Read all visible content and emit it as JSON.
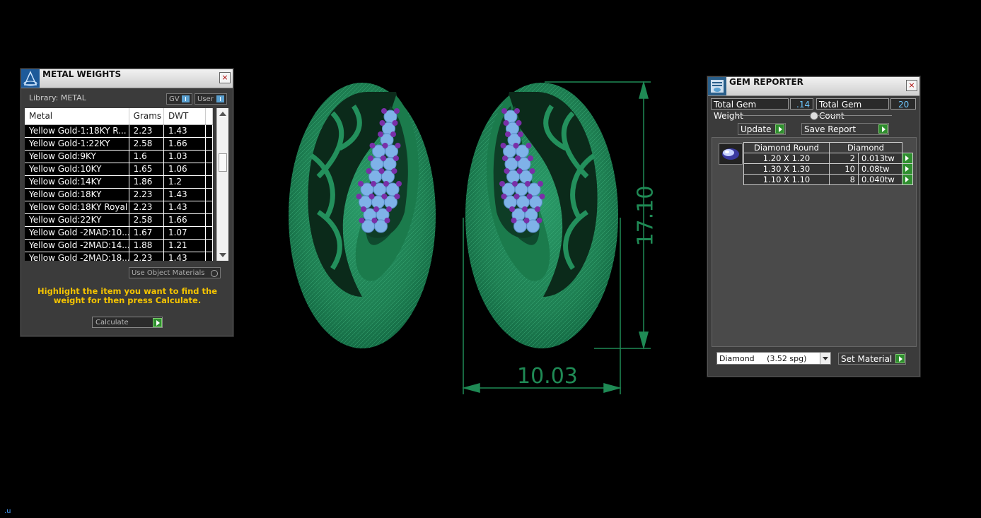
{
  "metal_weights": {
    "title": "METAL WEIGHTS",
    "close": "×",
    "library_label": "Library: METAL",
    "gv_label": "GV",
    "user_label": "User",
    "columns": [
      "Metal",
      "Grams",
      "DWT"
    ],
    "rows": [
      {
        "metal": "Yellow Gold-1:18KY R...",
        "grams": "2.23",
        "dwt": "1.43"
      },
      {
        "metal": "Yellow Gold-1:22KY",
        "grams": "2.58",
        "dwt": "1.66"
      },
      {
        "metal": "Yellow Gold:9KY",
        "grams": "1.6",
        "dwt": "1.03"
      },
      {
        "metal": "Yellow Gold:10KY",
        "grams": "1.65",
        "dwt": "1.06"
      },
      {
        "metal": "Yellow Gold:14KY",
        "grams": "1.86",
        "dwt": "1.2"
      },
      {
        "metal": "Yellow Gold:18KY",
        "grams": "2.23",
        "dwt": "1.43"
      },
      {
        "metal": "Yellow Gold:18KY Royal",
        "grams": "2.23",
        "dwt": "1.43"
      },
      {
        "metal": "Yellow Gold:22KY",
        "grams": "2.58",
        "dwt": "1.66"
      },
      {
        "metal": "Yellow Gold -2MAD:10...",
        "grams": "1.67",
        "dwt": "1.07"
      },
      {
        "metal": "Yellow Gold -2MAD:14...",
        "grams": "1.88",
        "dwt": "1.21"
      },
      {
        "metal": "Yellow Gold -2MAD:18...",
        "grams": "2.23",
        "dwt": "1.43"
      }
    ],
    "use_object_materials": "Use Object Materials",
    "hint": "Highlight the item you want to find the weight for then press Calculate.",
    "calculate_label": "Calculate"
  },
  "gem_reporter": {
    "title": "GEM REPORTER",
    "close": "×",
    "total_weight_label": "Total Gem Weight",
    "total_weight_value": ".14",
    "total_count_label": "Total Gem Count",
    "total_count_value": "20",
    "update_label": "Update",
    "save_report_label": "Save Report",
    "table_headers": [
      "Diamond Round",
      "Diamond"
    ],
    "gems": [
      {
        "size": "1.20 X 1.20",
        "count": "2",
        "weight": "0.013tw"
      },
      {
        "size": "1.30 X 1.30",
        "count": "10",
        "weight": "0.08tw"
      },
      {
        "size": "1.10 X 1.10",
        "count": "8",
        "weight": "0.040tw"
      }
    ],
    "material_selected": "Diamond     (3.52 spg)",
    "set_material_label": "Set Material"
  },
  "viewport": {
    "dim_width": "10.03",
    "dim_height": "17.10",
    "corner_text": ".u"
  },
  "colors": {
    "metal_green": "#1f8a55",
    "gem_blue": "#7fb2e8",
    "gem_purple": "#7a2fa8",
    "hint_yellow": "#f5c400"
  }
}
